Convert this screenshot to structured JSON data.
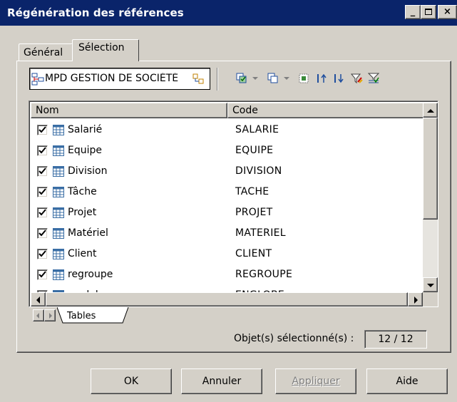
{
  "window": {
    "title": "Régénération des références",
    "controls": {
      "minimize": "_",
      "maximize": "□",
      "close": "×"
    }
  },
  "tabs": [
    {
      "label": "Général",
      "active": false
    },
    {
      "label": "Sélection",
      "active": true
    }
  ],
  "toolbar": {
    "model_selector": "MPD GESTION DE SOCIÉTÉ",
    "icons": [
      "select-all-icon",
      "select-dropdown-icon",
      "deselect-icon",
      "deselect-dropdown-icon",
      "select-none-icon",
      "move-up-icon",
      "move-down-icon",
      "filter-icon",
      "filter-selection-icon"
    ]
  },
  "list": {
    "columns": [
      "Nom",
      "Code"
    ],
    "rows": [
      {
        "name": "Salarié",
        "code": "SALARIE",
        "checked": true
      },
      {
        "name": "Equipe",
        "code": "EQUIPE",
        "checked": true
      },
      {
        "name": "Division",
        "code": "DIVISION",
        "checked": true
      },
      {
        "name": "Tâche",
        "code": "TACHE",
        "checked": true
      },
      {
        "name": "Projet",
        "code": "PROJET",
        "checked": true
      },
      {
        "name": "Matériel",
        "code": "MATERIEL",
        "checked": true
      },
      {
        "name": "Client",
        "code": "CLIENT",
        "checked": true
      },
      {
        "name": "regroupe",
        "code": "REGROUPE",
        "checked": true
      },
      {
        "name": "englobe",
        "code": "ENGLOBE",
        "checked": true
      }
    ]
  },
  "sheet_tabs": [
    {
      "label": "Tables",
      "active": true
    }
  ],
  "status": {
    "label": "Objet(s) sélectionné(s) :",
    "value": "12 / 12"
  },
  "buttons": {
    "ok": "OK",
    "cancel": "Annuler",
    "apply": "Appliquer",
    "help": "Aide"
  },
  "colors": {
    "titlebar": "#0a246a",
    "face": "#d4d0c8",
    "table_icon": "#3a6ea5"
  }
}
